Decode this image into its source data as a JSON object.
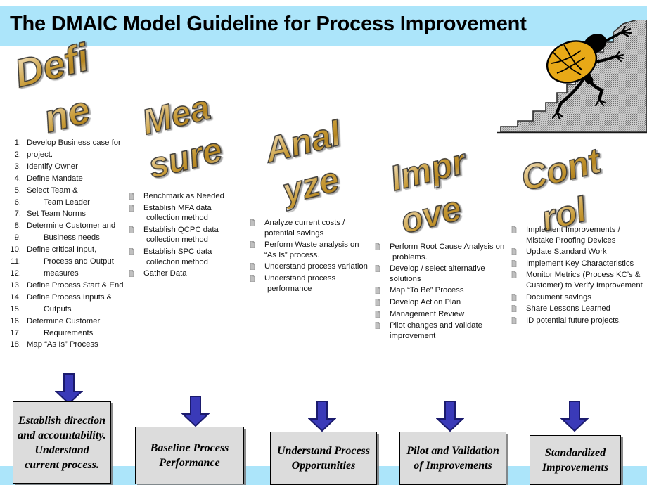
{
  "header": {
    "title": "The DMAIC Model Guideline for Process Improvement",
    "band_color": "#ACE5FA"
  },
  "colors": {
    "band": "#ACE5FA",
    "wordart_gold": "#C79A36",
    "wordart_light": "#F6E4BD",
    "arrow_fill": "#3A3AB8",
    "arrow_outline": "#1B1B6E",
    "box_fill": "#DCDCDC",
    "box_border": "#000000",
    "mountain_rock": "#BFBFBF",
    "backpack": "#E8A917"
  },
  "phases": [
    {
      "key": "define",
      "wordart": {
        "line1": "Defi",
        "line2": "ne"
      },
      "list_type": "numbered",
      "items": [
        {
          "n": "1.",
          "text": "Develop Business case for",
          "indent": 1
        },
        {
          "n": "2.",
          "text": "project.",
          "indent": 1
        },
        {
          "n": "3.",
          "text": "Identify Owner",
          "indent": 1
        },
        {
          "n": "4.",
          "text": "Define Mandate",
          "indent": 1
        },
        {
          "n": "5.",
          "text": "Select Team &",
          "indent": 1
        },
        {
          "n": "6.",
          "text": "Team Leader",
          "indent": 2
        },
        {
          "n": "7.",
          "text": "Set Team Norms",
          "indent": 1
        },
        {
          "n": "8.",
          "text": "Determine Customer and",
          "indent": 1
        },
        {
          "n": "9.",
          "text": "Business needs",
          "indent": 2
        },
        {
          "n": "10.",
          "text": "Define critical Input,",
          "indent": 1
        },
        {
          "n": "11.",
          "text": "Process and Output",
          "indent": 2
        },
        {
          "n": "12.",
          "text": "measures",
          "indent": 2
        },
        {
          "n": "13.",
          "text": "Define Process Start & End",
          "indent": 1
        },
        {
          "n": "14.",
          "text": "Define Process Inputs &",
          "indent": 1
        },
        {
          "n": "15.",
          "text": "Outputs",
          "indent": 2
        },
        {
          "n": "16.",
          "text": "Determine Customer",
          "indent": 1
        },
        {
          "n": "17.",
          "text": "Requirements",
          "indent": 2
        },
        {
          "n": "18.",
          "text": "Map “As Is” Process",
          "indent": 1
        }
      ]
    },
    {
      "key": "measure",
      "wordart": {
        "line1": "Mea",
        "line2": "sure"
      },
      "list_type": "bulleted",
      "items": [
        {
          "line1": "Benchmark as Needed",
          "line2": ""
        },
        {
          "line1": "Establish MFA data",
          "line2": "collection method"
        },
        {
          "line1": "Establish QCPC data",
          "line2": "collection method"
        },
        {
          "line1": "Establish SPC data",
          "line2": "collection method"
        },
        {
          "line1": "Gather Data",
          "line2": ""
        }
      ]
    },
    {
      "key": "analyze",
      "wordart": {
        "line1": "Anal",
        "line2": "yze"
      },
      "list_type": "bulleted",
      "items": [
        {
          "line1": "Analyze current costs /",
          "line2": "potential savings"
        },
        {
          "line1": "Perform Waste analysis on",
          "line2": "“As Is”  process."
        },
        {
          "line1": "Understand process variation",
          "line2": ""
        },
        {
          "line1": "Understand process",
          "line2": "performance"
        }
      ]
    },
    {
      "key": "improve",
      "wordart": {
        "line1": "Impr",
        "line2": "ove"
      },
      "list_type": "bulleted",
      "items": [
        {
          "line1": "Perform Root Cause Analysis on",
          "line2": "problems."
        },
        {
          "line1": "Develop / select alternative",
          "line2": "solutions"
        },
        {
          "line1": "Map “To Be” Process",
          "line2": ""
        },
        {
          "line1": "Develop Action Plan",
          "line2": ""
        },
        {
          "line1": "Management Review",
          "line2": ""
        },
        {
          "line1": "Pilot changes and validate",
          "line2": "improvement"
        }
      ]
    },
    {
      "key": "control",
      "wordart": {
        "line1": "Cont",
        "line2": "rol"
      },
      "list_type": "bulleted",
      "items": [
        {
          "line1": "Implement Improvements /",
          "line2": "Mistake Proofing Devices"
        },
        {
          "line1": "Update Standard Work",
          "line2": ""
        },
        {
          "line1": "Implement Key Characteristics",
          "line2": ""
        },
        {
          "line1": "Monitor Metrics (Process KC’s &",
          "line2": "Customer) to Verify Improvement"
        },
        {
          "line1": "Document savings",
          "line2": ""
        },
        {
          "line1": "Share Lessons Learned",
          "line2": ""
        },
        {
          "line1": "ID potential future projects.",
          "line2": ""
        }
      ]
    }
  ],
  "outcomes": [
    {
      "text": "Establish direction and accountability. Understand current process."
    },
    {
      "text": "Baseline Process Performance"
    },
    {
      "text": "Understand Process Opportunities"
    },
    {
      "text": "Pilot and Validation of Improvements"
    },
    {
      "text": "Standardized Improvements"
    }
  ],
  "icons": {
    "bullet": "document-icon",
    "arrow": "down-arrow-icon",
    "climber": "climber-icon",
    "mountain": "mountain-icon",
    "backpack": "backpack-icon"
  }
}
